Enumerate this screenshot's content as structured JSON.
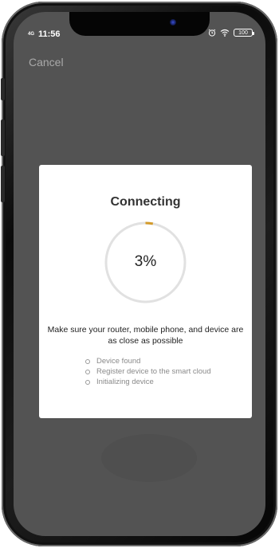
{
  "status_bar": {
    "network": "4G",
    "time": "11:56",
    "battery": "100"
  },
  "nav": {
    "cancel_label": "Cancel"
  },
  "dialog": {
    "title": "Connecting",
    "progress_fraction": 0.03,
    "progress_label": "3%",
    "hint_line1": "Make sure your router, mobile phone, and device are",
    "hint_line2": "as close as possible",
    "steps": [
      "Device found",
      "Register device to the smart cloud",
      "Initializing device"
    ]
  },
  "colors": {
    "overlay": "#535353",
    "progress_track": "#e1e1e1",
    "progress_fill": "#d39b2b",
    "dialog_bg": "#ffffff"
  },
  "icons": [
    "alarm-icon",
    "wifi-icon",
    "battery-icon",
    "bullet-icon"
  ]
}
